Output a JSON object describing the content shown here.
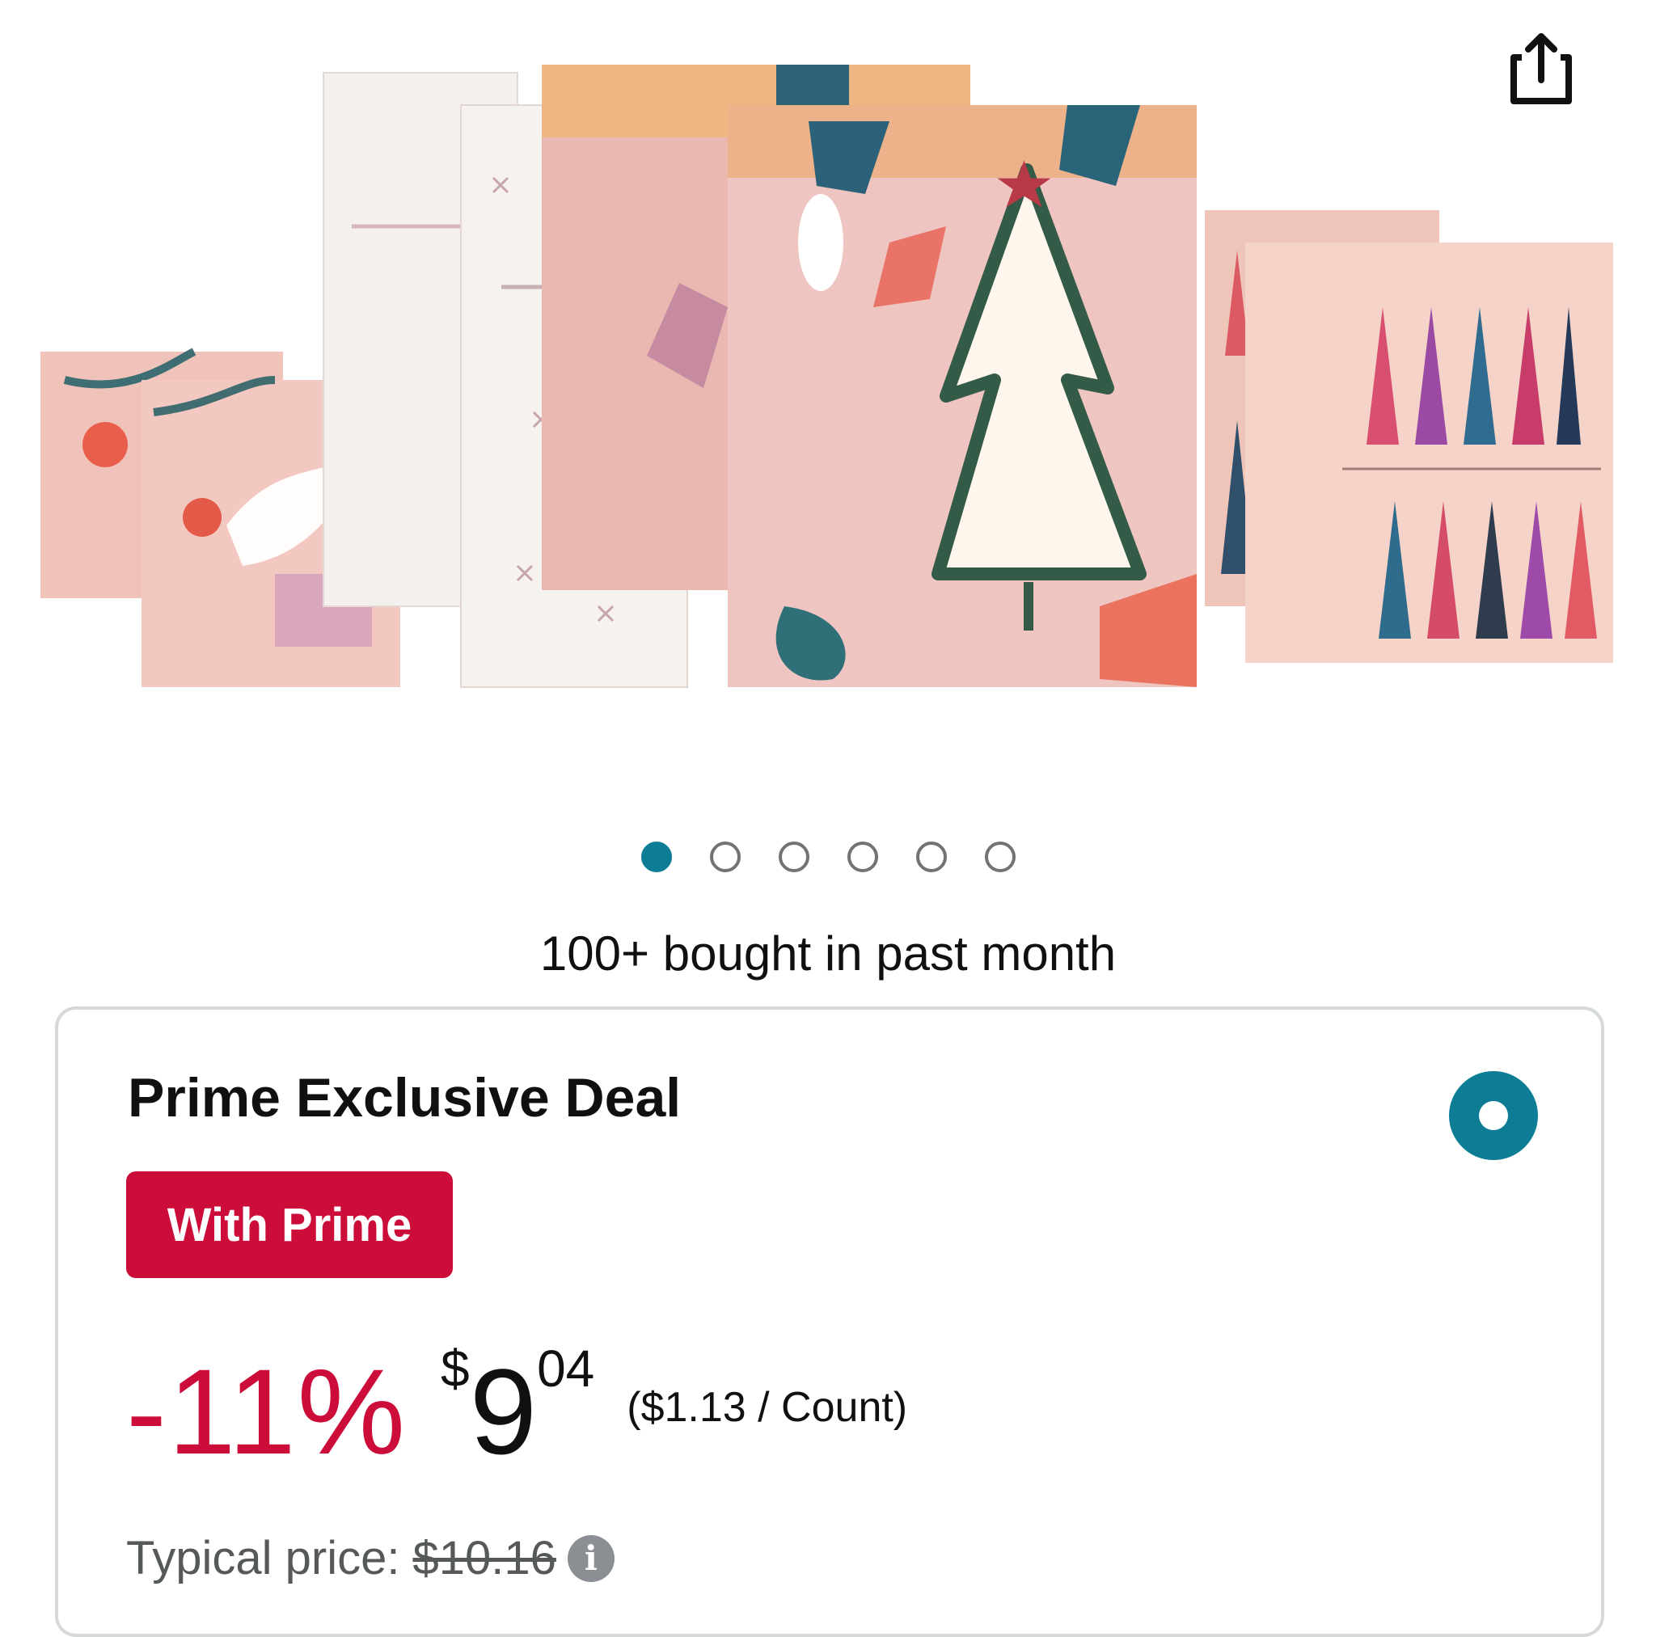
{
  "product": {
    "image_icon": "product-photo-gift-bags",
    "share_icon": "share-icon",
    "image_count": 6,
    "active_image_index": 0,
    "bought_text": "100+ bought in past month"
  },
  "deal": {
    "title": "Prime Exclusive Deal",
    "badge": "With Prime",
    "discount": "-11%",
    "price_symbol": "$",
    "price_whole": "9",
    "price_fraction": "04",
    "unit_price": "($1.13 / Count)",
    "typical_label": "Typical price:",
    "typical_value": "$10.16"
  },
  "colors": {
    "accent": "#0d7d95",
    "deal_red": "#cc0c39",
    "text": "#0f1111",
    "muted": "#565959",
    "border": "#d5d9d9"
  }
}
